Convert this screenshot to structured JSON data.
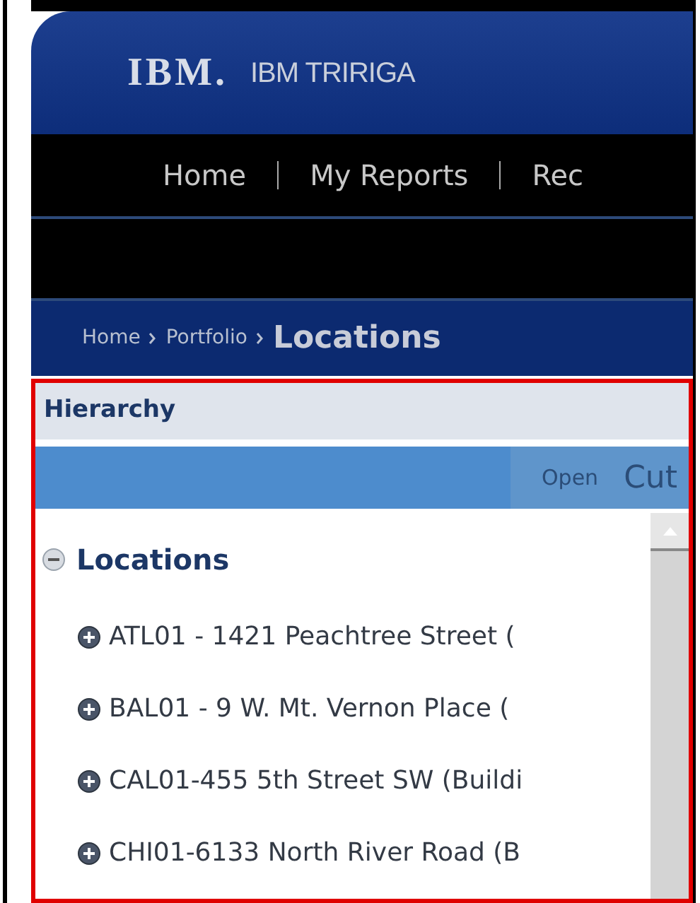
{
  "header": {
    "logo": "IBM.",
    "title": "IBM TRIRIGA"
  },
  "nav": [
    {
      "label": "Home"
    },
    {
      "label": "My Reports"
    },
    {
      "label": "Rec"
    }
  ],
  "breadcrumb": [
    {
      "label": "Home",
      "current": false
    },
    {
      "label": "Portfolio",
      "current": false
    },
    {
      "label": "Locations",
      "current": true
    }
  ],
  "panel": {
    "title": "Hierarchy",
    "toolbar": [
      {
        "label": "Open"
      },
      {
        "label": "Cut"
      }
    ],
    "tree": {
      "label": "Locations",
      "expanded": true,
      "children": [
        {
          "label": "ATL01 - 1421 Peachtree Street (",
          "expanded": false
        },
        {
          "label": "BAL01 - 9 W. Mt. Vernon Place (",
          "expanded": false
        },
        {
          "label": "CAL01-455 5th Street SW (Buildi",
          "expanded": false
        },
        {
          "label": "CHI01-6133 North River Road (B",
          "expanded": false
        }
      ]
    }
  }
}
